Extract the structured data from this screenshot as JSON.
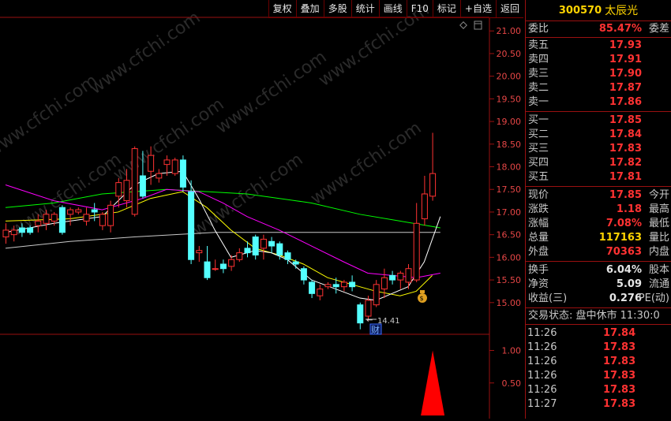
{
  "toolbar": [
    "复权",
    "叠加",
    "多股",
    "统计",
    "画线",
    "F10",
    "标记",
    "+自选",
    "返回"
  ],
  "watermark": "www.cfchi.com",
  "price_axis": [
    "21.00",
    "20.50",
    "20.00",
    "19.50",
    "19.00",
    "18.50",
    "18.00",
    "17.50",
    "17.00",
    "16.50",
    "16.00",
    "15.50",
    "15.00"
  ],
  "indicator_axis": [
    "1.00",
    "0.50"
  ],
  "low_marker": "14.41",
  "finance_marker": "财",
  "colors": {
    "up": "#ff3232",
    "down": "#54ffff",
    "ma5": "#ffffff",
    "ma10": "#ffff00",
    "ma20": "#ff00ff",
    "ma60": "#00ff00",
    "ma120": "#c8c8c8",
    "frame": "#9a1010"
  },
  "stock": {
    "code": "300570",
    "name": "太辰光"
  },
  "weibi": {
    "label": "委比",
    "value": "85.47%",
    "right": "委差"
  },
  "sell": [
    {
      "label": "卖五",
      "price": "17.93"
    },
    {
      "label": "卖四",
      "price": "17.91"
    },
    {
      "label": "卖三",
      "price": "17.90"
    },
    {
      "label": "卖二",
      "price": "17.87"
    },
    {
      "label": "卖一",
      "price": "17.86"
    }
  ],
  "buy": [
    {
      "label": "买一",
      "price": "17.85"
    },
    {
      "label": "买二",
      "price": "17.84"
    },
    {
      "label": "买三",
      "price": "17.83"
    },
    {
      "label": "买四",
      "price": "17.82"
    },
    {
      "label": "买五",
      "price": "17.81"
    }
  ],
  "quote1": [
    {
      "label": "现价",
      "value": "17.85",
      "right": "今开"
    },
    {
      "label": "涨跌",
      "value": "1.18",
      "right": "最高"
    },
    {
      "label": "涨幅",
      "value": "7.08%",
      "right": "最低"
    },
    {
      "label": "总量",
      "value": "117163",
      "right": "量比"
    },
    {
      "label": "外盘",
      "value": "70363",
      "right": "内盘"
    }
  ],
  "quote2": [
    {
      "label": "换手",
      "value": "6.04%",
      "right": "股本"
    },
    {
      "label": "净资",
      "value": "5.09",
      "right": "流通"
    },
    {
      "label": "收益(三)",
      "value": "0.276",
      "right": "PE(动)"
    }
  ],
  "trade_status": "交易状态: 盘中休市  11:30:0",
  "trades": [
    {
      "time": "11:26",
      "price": "17.84"
    },
    {
      "time": "11:26",
      "price": "17.83"
    },
    {
      "time": "11:26",
      "price": "17.83"
    },
    {
      "time": "11:26",
      "price": "17.83"
    },
    {
      "time": "11:26",
      "price": "17.83"
    },
    {
      "time": "11:27",
      "price": "17.83"
    }
  ],
  "chart_data": {
    "type": "candlestick",
    "price_range": [
      14.3,
      21.3
    ],
    "candles": [
      [
        16.45,
        16.6,
        16.3,
        16.75
      ],
      [
        16.5,
        16.6,
        16.35,
        16.7
      ],
      [
        16.65,
        16.55,
        16.45,
        16.75
      ],
      [
        16.65,
        16.55,
        16.5,
        16.7
      ],
      [
        16.7,
        16.8,
        16.55,
        16.95
      ],
      [
        16.75,
        16.95,
        16.6,
        17.05
      ],
      [
        16.8,
        16.95,
        16.7,
        17.0
      ],
      [
        17.1,
        16.55,
        16.5,
        17.15
      ],
      [
        16.95,
        17.05,
        16.7,
        17.1
      ],
      [
        17.0,
        17.05,
        16.95,
        17.1
      ],
      [
        16.8,
        16.95,
        16.7,
        17.1
      ],
      [
        17.05,
        17.0,
        16.8,
        17.2
      ],
      [
        16.7,
        16.95,
        16.6,
        17.0
      ],
      [
        16.7,
        17.15,
        16.55,
        17.25
      ],
      [
        17.35,
        17.65,
        17.1,
        17.75
      ],
      [
        17.25,
        17.7,
        17.1,
        17.95
      ],
      [
        16.95,
        18.4,
        16.9,
        18.45
      ],
      [
        17.8,
        17.35,
        17.3,
        18.35
      ],
      [
        17.9,
        18.25,
        17.6,
        18.45
      ],
      [
        17.75,
        17.85,
        17.65,
        17.95
      ],
      [
        18.05,
        18.15,
        17.8,
        18.25
      ],
      [
        17.85,
        18.15,
        17.8,
        18.2
      ],
      [
        18.15,
        17.55,
        17.45,
        18.25
      ],
      [
        17.45,
        15.95,
        15.85,
        17.7
      ],
      [
        16.1,
        16.15,
        15.9,
        16.25
      ],
      [
        15.9,
        15.55,
        15.5,
        16.25
      ],
      [
        15.75,
        15.75,
        15.7,
        15.95
      ],
      [
        15.85,
        15.75,
        15.65,
        15.95
      ],
      [
        15.8,
        15.95,
        15.7,
        16.05
      ],
      [
        15.95,
        16.1,
        15.9,
        16.2
      ],
      [
        16.2,
        16.1,
        16.0,
        16.35
      ],
      [
        16.45,
        16.05,
        15.95,
        16.5
      ],
      [
        16.2,
        16.4,
        15.95,
        16.5
      ],
      [
        16.35,
        16.25,
        16.1,
        16.45
      ],
      [
        16.3,
        16.05,
        15.95,
        16.35
      ],
      [
        16.1,
        15.95,
        15.85,
        16.15
      ],
      [
        15.9,
        15.85,
        15.75,
        15.95
      ],
      [
        15.75,
        15.5,
        15.4,
        15.8
      ],
      [
        15.45,
        15.2,
        15.1,
        15.5
      ],
      [
        15.15,
        15.3,
        15.05,
        15.4
      ],
      [
        15.35,
        15.4,
        15.3,
        15.45
      ],
      [
        15.4,
        15.35,
        15.2,
        15.55
      ],
      [
        15.35,
        15.45,
        15.25,
        15.5
      ],
      [
        15.45,
        15.35,
        15.25,
        15.6
      ],
      [
        14.95,
        14.55,
        14.41,
        15.0
      ],
      [
        14.7,
        15.05,
        14.6,
        15.15
      ],
      [
        14.95,
        15.4,
        14.9,
        15.5
      ],
      [
        15.3,
        15.55,
        15.1,
        15.75
      ],
      [
        15.6,
        15.5,
        15.4,
        15.7
      ],
      [
        15.5,
        15.65,
        15.3,
        15.7
      ],
      [
        15.45,
        15.75,
        15.3,
        15.85
      ],
      [
        15.5,
        16.75,
        15.45,
        17.2
      ],
      [
        16.85,
        17.4,
        16.7,
        17.8
      ]
    ],
    "last_candle": [
      17.35,
      17.85,
      17.25,
      18.75
    ],
    "indicator": {
      "values": [
        0,
        0,
        0,
        0,
        0,
        0,
        0,
        0,
        0,
        0,
        0,
        0,
        0,
        0,
        0,
        0,
        0,
        0,
        0,
        0,
        0,
        0,
        0,
        0,
        0,
        0,
        0,
        0,
        0,
        0,
        0,
        0,
        0,
        0,
        0,
        0,
        0,
        0,
        0,
        0,
        0,
        0,
        0,
        0,
        0,
        0,
        0,
        0,
        0,
        0,
        0,
        0,
        0,
        1.0
      ],
      "range": [
        0,
        1.2
      ]
    },
    "ma5": [
      [
        0,
        16.55
      ],
      [
        6,
        16.75
      ],
      [
        12,
        16.9
      ],
      [
        16,
        17.6
      ],
      [
        19,
        17.85
      ],
      [
        22,
        17.9
      ],
      [
        24,
        17.3
      ],
      [
        26,
        16.6
      ],
      [
        28,
        16.0
      ],
      [
        31,
        16.15
      ],
      [
        33,
        16.1
      ],
      [
        35,
        15.95
      ],
      [
        38,
        15.5
      ],
      [
        41,
        15.3
      ],
      [
        44,
        15.1
      ],
      [
        46,
        15.05
      ],
      [
        48,
        15.2
      ],
      [
        50,
        15.35
      ],
      [
        52,
        15.9
      ],
      [
        54,
        16.9
      ]
    ],
    "ma10": [
      [
        0,
        16.8
      ],
      [
        8,
        16.85
      ],
      [
        14,
        17.0
      ],
      [
        18,
        17.3
      ],
      [
        22,
        17.45
      ],
      [
        25,
        17.1
      ],
      [
        28,
        16.6
      ],
      [
        31,
        16.2
      ],
      [
        34,
        16.05
      ],
      [
        37,
        15.85
      ],
      [
        40,
        15.55
      ],
      [
        43,
        15.4
      ],
      [
        46,
        15.25
      ],
      [
        49,
        15.15
      ],
      [
        51,
        15.25
      ],
      [
        53,
        15.6
      ]
    ],
    "ma20": [
      [
        0,
        17.6
      ],
      [
        6,
        17.25
      ],
      [
        12,
        17.05
      ],
      [
        17,
        17.3
      ],
      [
        20,
        17.5
      ],
      [
        24,
        17.45
      ],
      [
        27,
        17.2
      ],
      [
        30,
        16.9
      ],
      [
        34,
        16.6
      ],
      [
        38,
        16.25
      ],
      [
        42,
        15.9
      ],
      [
        45,
        15.65
      ],
      [
        48,
        15.6
      ],
      [
        51,
        15.55
      ],
      [
        54,
        15.65
      ]
    ],
    "ma60": [
      [
        0,
        17.1
      ],
      [
        6,
        17.2
      ],
      [
        12,
        17.4
      ],
      [
        20,
        17.5
      ],
      [
        30,
        17.4
      ],
      [
        38,
        17.2
      ],
      [
        44,
        16.95
      ],
      [
        49,
        16.8
      ],
      [
        54,
        16.65
      ]
    ],
    "ma120": [
      [
        0,
        16.2
      ],
      [
        8,
        16.35
      ],
      [
        16,
        16.45
      ],
      [
        26,
        16.55
      ],
      [
        36,
        16.55
      ],
      [
        46,
        16.55
      ],
      [
        54,
        16.55
      ]
    ]
  }
}
